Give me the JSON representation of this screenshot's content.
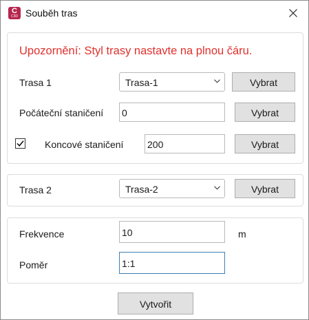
{
  "window": {
    "title": "Souběh tras",
    "app_icon": {
      "name": "civil-3d-app-icon",
      "letter": "C",
      "sub_label": "C3D",
      "color": "#b7254e"
    },
    "close_icon": "close-icon"
  },
  "warning": {
    "text": "Upozornění: Styl trasy nastavte na plnou čáru.",
    "color": "#e0312d"
  },
  "route1": {
    "label": "Trasa 1",
    "selected": "Trasa-1",
    "select_button": "Vybrat",
    "start_station": {
      "label": "Počáteční staničení",
      "value": "0",
      "select_button": "Vybrat"
    },
    "end_station": {
      "checked": true,
      "label": "Koncové staničení",
      "value": "200",
      "select_button": "Vybrat"
    }
  },
  "route2": {
    "label": "Trasa 2",
    "selected": "Trasa-2",
    "select_button": "Vybrat"
  },
  "params": {
    "frequency": {
      "label": "Frekvence",
      "value": "10",
      "unit": "m"
    },
    "ratio": {
      "label": "Poměr",
      "value": "1:1"
    }
  },
  "create_button": "Vytvořit"
}
